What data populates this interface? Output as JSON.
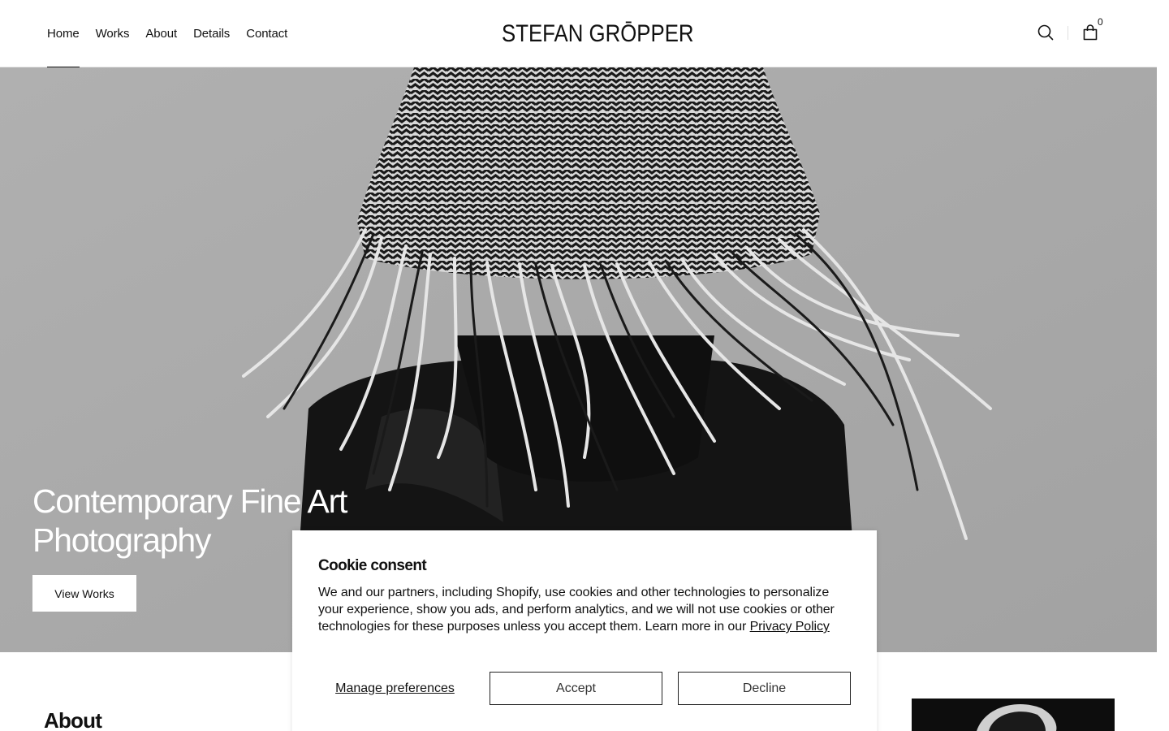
{
  "nav": {
    "items": [
      {
        "label": "Home",
        "active": true
      },
      {
        "label": "Works"
      },
      {
        "label": "About"
      },
      {
        "label": "Details"
      },
      {
        "label": "Contact"
      }
    ]
  },
  "brand": {
    "logo_text": "STEFAN GRŌPPER"
  },
  "header_icons": {
    "search": "search-icon",
    "cart": "shopping-bag-icon",
    "cart_count": "0"
  },
  "hero": {
    "title_line1": "Contemporary Fine Art",
    "title_line2": "Photography",
    "button_label": "View Works",
    "image_description_icon": "woven-hat-portrait"
  },
  "about": {
    "heading": "About"
  },
  "cookie": {
    "title": "Cookie consent",
    "body": "We and our partners, including Shopify, use cookies and other technologies to personalize your experience, show you ads, and perform analytics, and we will not use cookies or other technologies for these purposes unless you accept them. Learn more in our",
    "policy_link": "Privacy Policy",
    "manage_label": "Manage preferences",
    "accept_label": "Accept",
    "decline_label": "Decline"
  },
  "colors": {
    "text": "#111111",
    "hero_bg": "#a9a9a9",
    "white": "#ffffff"
  }
}
